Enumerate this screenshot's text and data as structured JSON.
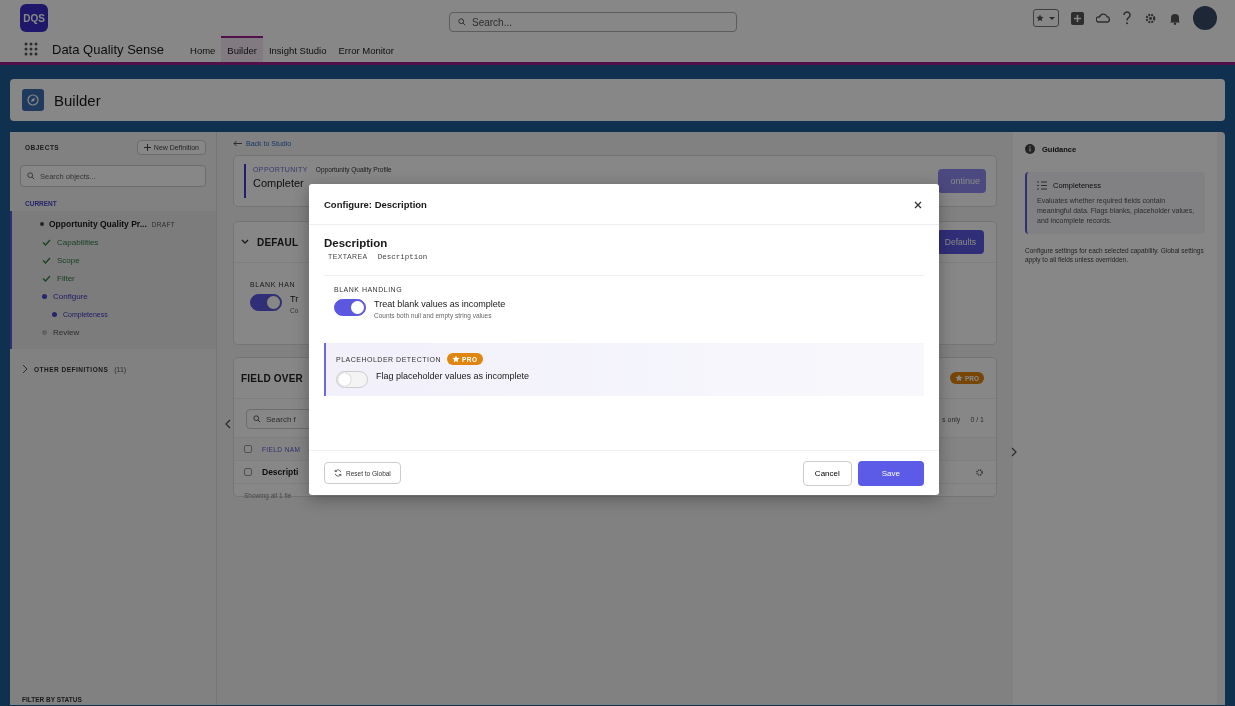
{
  "header": {
    "logo": "DQS",
    "search_placeholder": "Search...",
    "app_name": "Data Quality Sense",
    "nav": [
      {
        "label": "Home",
        "selected": false
      },
      {
        "label": "Builder",
        "selected": true
      },
      {
        "label": "Insight Studio",
        "selected": false
      },
      {
        "label": "Error Monitor",
        "selected": false
      }
    ]
  },
  "page_header": {
    "title": "Builder"
  },
  "objects_panel": {
    "title": "OBJECTS",
    "new_button": "New Definition",
    "search_placeholder": "Search objects...",
    "section": "CURRENT",
    "definition": {
      "name": "Opportunity Quality Pr...",
      "badge": "DRAFT"
    },
    "steps": [
      {
        "label": "Capabilities",
        "kind": "done"
      },
      {
        "label": "Scope",
        "kind": "done"
      },
      {
        "label": "Filter",
        "kind": "done"
      },
      {
        "label": "Configure",
        "kind": "current",
        "children": [
          {
            "label": "Completeness",
            "kind": "current"
          }
        ]
      },
      {
        "label": "Review",
        "kind": "pending"
      }
    ],
    "other": {
      "label": "OTHER DEFINITIONS",
      "count": "(11)",
      "expanded": false
    },
    "filter_label": "FILTER BY STATUS"
  },
  "studio": {
    "back_link": "Back to Studio",
    "profile": {
      "object": "OPPORTUNITY",
      "name": "Opportunity Quality Profile",
      "title": "Completer",
      "continue_button": "ontinue"
    },
    "defaults_card": {
      "title": "DEFAUL",
      "expanded": true,
      "button": "Defaults",
      "section": "BLANK HAN",
      "toggle_on": true,
      "label": "Tr",
      "hint": "Co"
    },
    "overrides_card": {
      "title": "FIELD OVER",
      "badge": "PRO",
      "search_placeholder": "Search f",
      "filter_label": "s only",
      "count": "0 / 1",
      "column": "FIELD NAM",
      "select_all_checked": false,
      "rows": [
        {
          "field": "Descripti",
          "checked": false
        }
      ],
      "footer": "Showing all 1 fie"
    }
  },
  "guidance": {
    "title": "Guidance",
    "card": {
      "title": "Completeness",
      "text": "Evaluates whether required fields contain meaningful data. Flags blanks, placeholder values, and incomplete records."
    },
    "note": "Configure settings for each selected capability. Global settings apply to all fields unless overridden."
  },
  "modal": {
    "title": "Configure: Description",
    "field": {
      "label": "Description",
      "type": "TEXTAREA",
      "api_name": "Description"
    },
    "sections": [
      {
        "kind": "standard",
        "title": "BLANK HANDLING",
        "toggle": {
          "on": true,
          "label": "Treat blank values as incomplete",
          "hint": "Counts both null and empty string values"
        }
      },
      {
        "kind": "pro",
        "title": "PLACEHOLDER DETECTION",
        "badge": "PRO",
        "toggle": {
          "on": false,
          "label": "Flag placeholder values as incomplete"
        }
      }
    ],
    "reset_button": "Reset to Global",
    "cancel_button": "Cancel",
    "save_button": "Save"
  }
}
